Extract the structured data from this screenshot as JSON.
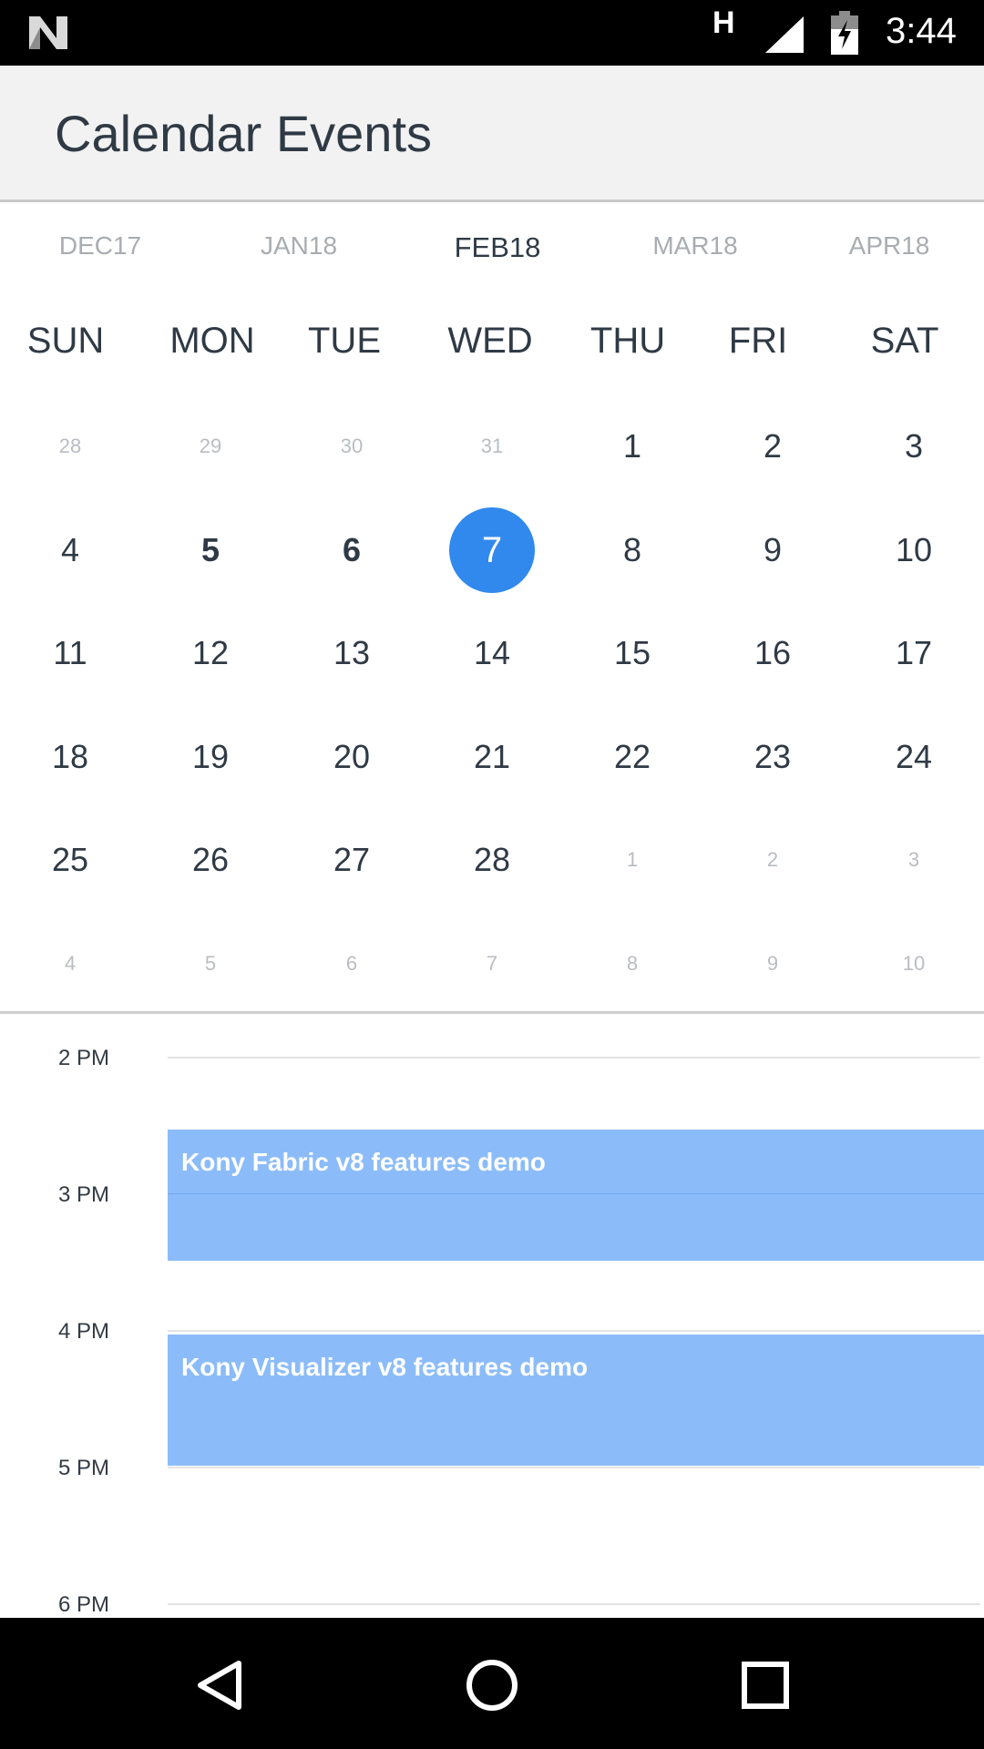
{
  "status_bar": {
    "network_type": "H",
    "time": "3:44",
    "icons": [
      "n-logo-icon",
      "signal-icon",
      "battery-charging-icon"
    ]
  },
  "app_bar": {
    "title": "Calendar Events"
  },
  "months": [
    {
      "label": "DEC17",
      "active": false
    },
    {
      "label": "JAN18",
      "active": false
    },
    {
      "label": "FEB18",
      "active": true
    },
    {
      "label": "MAR18",
      "active": false
    },
    {
      "label": "APR18",
      "active": false
    }
  ],
  "weekdays": [
    "SUN",
    "MON",
    "TUE",
    "WED",
    "THU",
    "FRI",
    "SAT"
  ],
  "calendar_weeks": [
    [
      {
        "d": "28",
        "m": true
      },
      {
        "d": "29",
        "m": true
      },
      {
        "d": "30",
        "m": true
      },
      {
        "d": "31",
        "m": true
      },
      {
        "d": "1"
      },
      {
        "d": "2"
      },
      {
        "d": "3"
      }
    ],
    [
      {
        "d": "4"
      },
      {
        "d": "5",
        "b": true
      },
      {
        "d": "6",
        "b": true
      },
      {
        "d": "7",
        "s": true
      },
      {
        "d": "8"
      },
      {
        "d": "9"
      },
      {
        "d": "10"
      }
    ],
    [
      {
        "d": "11"
      },
      {
        "d": "12"
      },
      {
        "d": "13"
      },
      {
        "d": "14"
      },
      {
        "d": "15"
      },
      {
        "d": "16"
      },
      {
        "d": "17"
      }
    ],
    [
      {
        "d": "18"
      },
      {
        "d": "19"
      },
      {
        "d": "20"
      },
      {
        "d": "21"
      },
      {
        "d": "22"
      },
      {
        "d": "23"
      },
      {
        "d": "24"
      }
    ],
    [
      {
        "d": "25"
      },
      {
        "d": "26"
      },
      {
        "d": "27"
      },
      {
        "d": "28"
      },
      {
        "d": "1",
        "m": true
      },
      {
        "d": "2",
        "m": true
      },
      {
        "d": "3",
        "m": true
      }
    ],
    [
      {
        "d": "4",
        "m": true
      },
      {
        "d": "5",
        "m": true
      },
      {
        "d": "6",
        "m": true
      },
      {
        "d": "7",
        "m": true
      },
      {
        "d": "8",
        "m": true
      },
      {
        "d": "9",
        "m": true
      },
      {
        "d": "10",
        "m": true
      }
    ]
  ],
  "timeline": {
    "hours": [
      "2 PM",
      "3 PM",
      "4 PM",
      "5 PM",
      "6 PM"
    ],
    "events": [
      {
        "title": "Kony Fabric v8 features demo"
      },
      {
        "title": "Kony Visualizer v8 features demo"
      }
    ]
  },
  "colors": {
    "accent": "#3189ee",
    "event": "#8bbcf9",
    "text": "#2f3a45",
    "muted": "#b9bdc2"
  },
  "nav_bar": {
    "icons": [
      "back-triangle-icon",
      "home-circle-icon",
      "recents-square-icon"
    ]
  }
}
